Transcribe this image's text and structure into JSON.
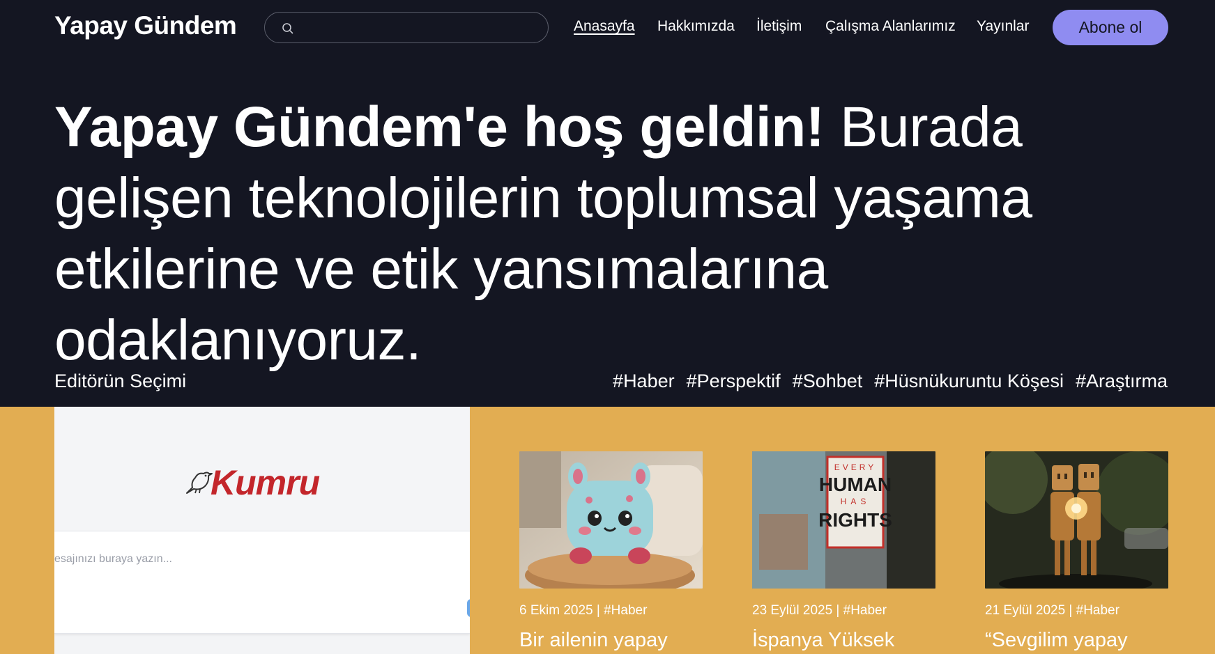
{
  "header": {
    "brand": "Yapay Gündem",
    "search": {
      "placeholder": "",
      "value": ""
    },
    "nav": [
      {
        "label": "Anasayfa",
        "active": true
      },
      {
        "label": "Hakkımızda",
        "active": false
      },
      {
        "label": "İletişim",
        "active": false
      },
      {
        "label": "Çalışma Alanlarımız",
        "active": false
      },
      {
        "label": "Yayınlar",
        "active": false
      }
    ],
    "subscribe_label": "Abone ol"
  },
  "hero": {
    "bold": "Yapay Gündem'e hoş geldin!",
    "rest": " Burada gelişen teknolojilerin toplumsal yaşama etkilerine ve etik yansımalarına odaklanıyoruz."
  },
  "section": {
    "editors_pick": "Editörün Seçimi",
    "tags": [
      "#Haber",
      "#Perspektif",
      "#Sohbet",
      "#Hüsnükuruntu Köşesi",
      "#Araştırma"
    ]
  },
  "featured": {
    "logo_text": "Kumru",
    "input_placeholder": "esajınızı buraya yazın..."
  },
  "cards": [
    {
      "meta": "6 Ekim 2025 | #Haber",
      "title": "Bir ailenin yapay",
      "image": "plush-toy"
    },
    {
      "meta": "23 Eylül 2025 | #Haber",
      "title": "İspanya Yüksek",
      "image": "human-rights-sticker",
      "image_text": [
        "EVERY",
        "HUMAN",
        "HAS",
        "RIGHTS"
      ]
    },
    {
      "meta": "21 Eylül 2025 | #Haber",
      "title": "“Sevgilim yapay",
      "image": "robot-couple"
    }
  ],
  "colors": {
    "background": "#141622",
    "accent": "#8f8cf1",
    "section_yellow": "#e2ad52",
    "logo_red": "#c3262b"
  }
}
